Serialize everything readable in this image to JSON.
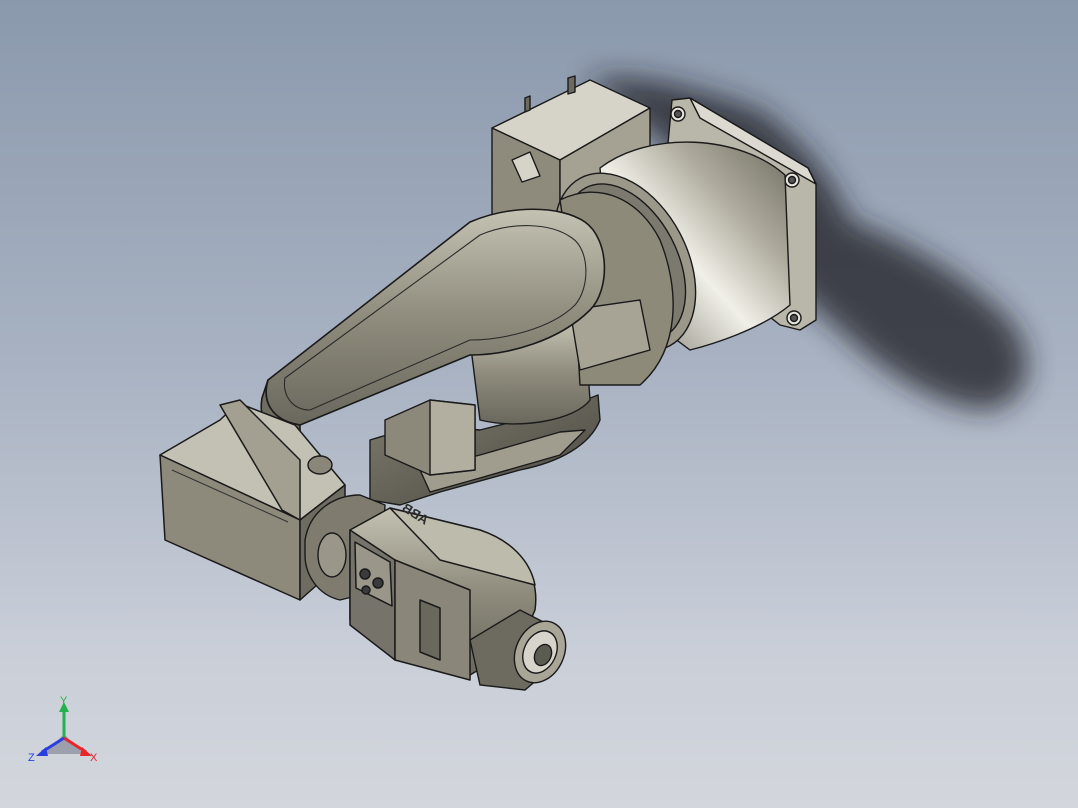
{
  "model": {
    "name_label": "",
    "brand_marking": "ABB"
  },
  "triad": {
    "x_label": "X",
    "y_label": "Y",
    "z_label": "Z",
    "x_color": "#e8262a",
    "y_color": "#22b14c",
    "z_color": "#2a3fe0"
  },
  "colors": {
    "background_top": "#8b99ad",
    "background_bottom": "#d3d6dc",
    "metal": "#8d8a7a",
    "edge": "#1a1a1a"
  }
}
